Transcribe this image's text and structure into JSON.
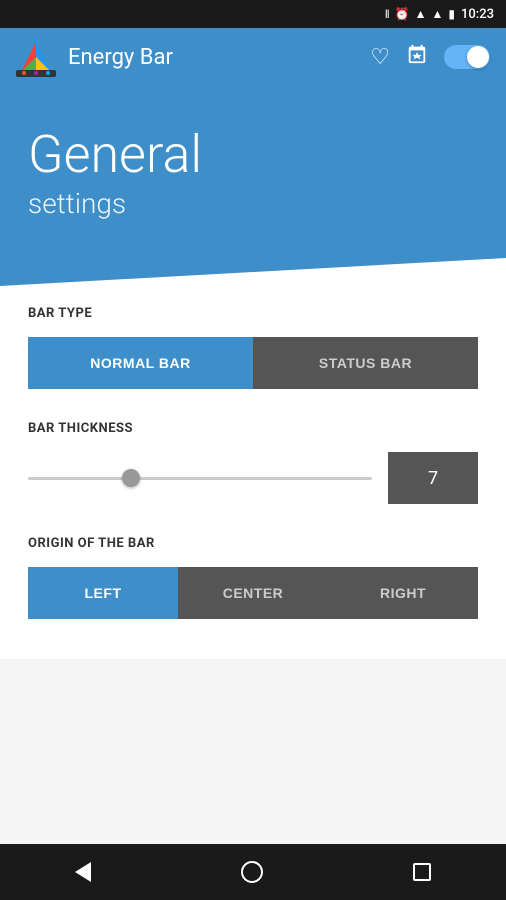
{
  "statusBar": {
    "time": "10:23",
    "icons": [
      "vibrate",
      "alarm",
      "signal1",
      "signal2",
      "battery"
    ]
  },
  "appBar": {
    "title": "Energy Bar",
    "actions": {
      "favorite": "♡",
      "store": "▶"
    },
    "toggleOn": true
  },
  "header": {
    "title": "General",
    "subtitle": "settings"
  },
  "sections": {
    "barType": {
      "label": "BAR TYPE",
      "options": [
        {
          "id": "normal",
          "label": "NORMAL BAR",
          "active": true
        },
        {
          "id": "status",
          "label": "STATUS BAR",
          "active": false
        }
      ]
    },
    "barThickness": {
      "label": "BAR THICKNESS",
      "value": "7",
      "sliderPercent": 30
    },
    "originOfBar": {
      "label": "ORIGIN OF THE BAR",
      "options": [
        {
          "id": "left",
          "label": "LEFT",
          "active": true
        },
        {
          "id": "center",
          "label": "CENTER",
          "active": false
        },
        {
          "id": "right",
          "label": "RIGHT",
          "active": false
        }
      ]
    }
  },
  "colors": {
    "blue": "#3d8ec9",
    "darkBtn": "#555555",
    "darkBtnText": "#cccccc",
    "activeBtn": "#3d8ec9"
  }
}
